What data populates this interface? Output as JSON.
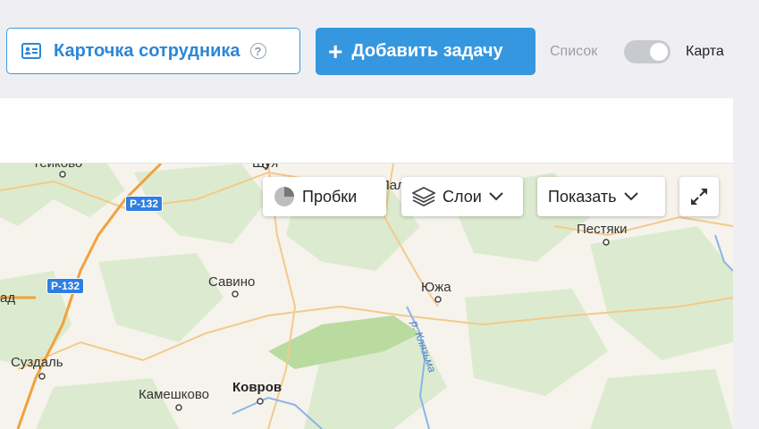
{
  "toolbar": {
    "employee_card_label": "Карточка сотрудника",
    "help_glyph": "?",
    "add_task_label": "Добавить задачу",
    "add_task_icon": "+",
    "view_list_label": "Список",
    "view_map_label": "Карта",
    "view_mode": "Карта"
  },
  "map": {
    "controls": {
      "traffic_label": "Пробки",
      "layers_label": "Слои",
      "show_label": "Показать"
    },
    "places": {
      "teikovo": "Тейково",
      "shuya": "Шуя",
      "pal": "Пал",
      "savino": "Савино",
      "yuzha": "Южа",
      "pestyaki": "Пестяки",
      "suzdal": "Суздаль",
      "kameshkovo": "Камешково",
      "kovrov": "Ковров",
      "ad": "ад"
    },
    "roads": [
      "Р-132",
      "Р-132"
    ],
    "river": "р. Клязьма",
    "colors": {
      "accent": "#3597df",
      "forest": "#d6ecc8",
      "road_shield": "#2f7fe0"
    }
  }
}
